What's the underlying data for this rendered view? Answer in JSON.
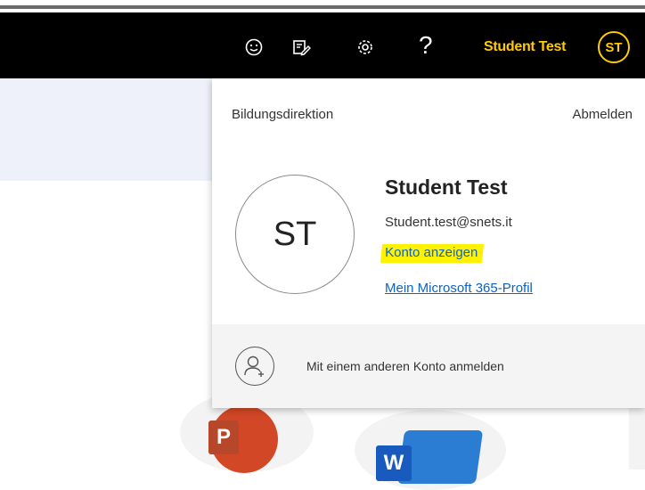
{
  "header": {
    "user_name": "Student Test",
    "avatar_initials": "ST",
    "help_glyph": "?",
    "icons": [
      "smiley-icon",
      "feedback-icon",
      "gear-icon",
      "help-icon"
    ],
    "name_color": "#ffcc00"
  },
  "account_panel": {
    "organization": "Bildungsdirektion",
    "sign_out": "Abmelden",
    "avatar_initials": "ST",
    "name": "Student Test",
    "email": "Student.test@snets.it",
    "view_account": "Konto anzeigen",
    "profile_link": "Mein Microsoft 365-Profil",
    "other_account": "Mit einem anderen Konto anmelden",
    "link_color": "#0b63c5",
    "highlight_color": "#fff200"
  },
  "apps": [
    {
      "name": "PowerPoint",
      "letter": "P",
      "color": "#d24726"
    },
    {
      "name": "Word",
      "letter": "W",
      "color": "#2b7cd3"
    }
  ]
}
